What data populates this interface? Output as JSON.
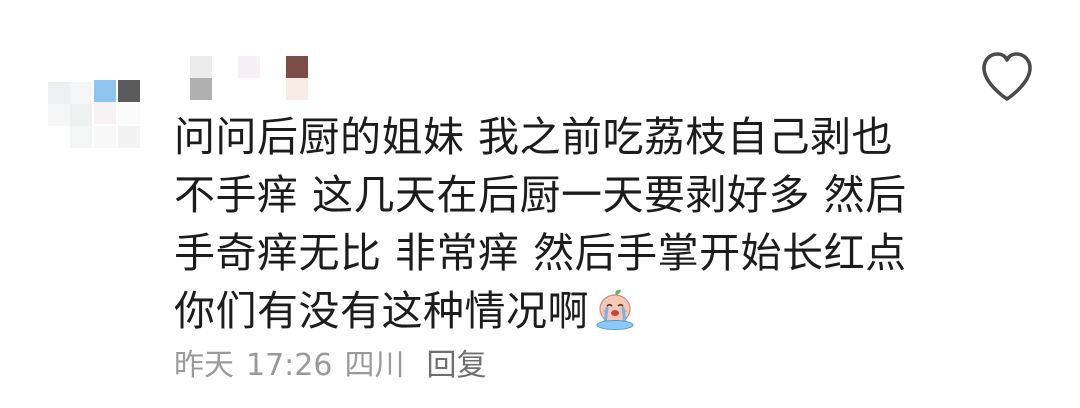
{
  "comment": {
    "text_lines": [
      "问问后厨的姐妹 我之前吃荔枝自己剥也",
      "不手痒 这几天在后厨一天要剥好多 然后",
      "手奇痒无比 非常痒 然后手掌开始长红点",
      "你们有没有这种情况啊"
    ],
    "emoji": "crying-face-emoji",
    "meta": {
      "date": "昨天",
      "time": "17:26",
      "location": "四川",
      "reply_label": "回复"
    }
  },
  "icons": {
    "like": "heart-outline-icon"
  },
  "colors": {
    "text": "#1c1c1c",
    "meta": "#9a9a9a",
    "reply": "#6f6f6f",
    "icon": "#4a4a4a"
  }
}
